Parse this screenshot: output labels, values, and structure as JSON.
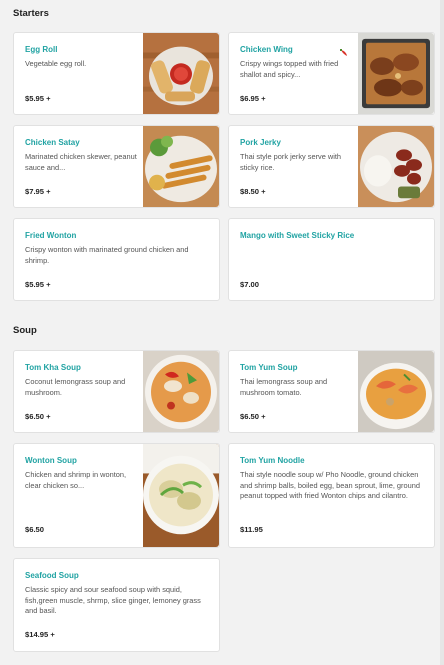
{
  "sections": [
    {
      "title": "Starters",
      "items": [
        {
          "name": "Egg Roll",
          "description": "Vegetable egg roll.",
          "price": "$5.95 +",
          "image": "egg-roll-photo"
        },
        {
          "name": "Chicken Wing",
          "description": "Crispy wings topped with fried shallot and spicy...",
          "price": "$6.95 +",
          "image": "chicken-wing-photo",
          "badge_icon": "chili-pepper-icon"
        },
        {
          "name": "Chicken Satay",
          "description": "Marinated chicken skewer, peanut sauce and...",
          "price": "$7.95 +",
          "image": "chicken-satay-photo"
        },
        {
          "name": "Pork Jerky",
          "description": "Thai style pork jerky serve with sticky rice.",
          "price": "$8.50 +",
          "image": "pork-jerky-photo"
        },
        {
          "name": "Fried Wonton",
          "description": "Crispy wonton with marinated ground chicken and shrimp.",
          "price": "$5.95 +"
        },
        {
          "name": "Mango with Sweet Sticky Rice",
          "description": "",
          "price": "$7.00"
        }
      ]
    },
    {
      "title": "Soup",
      "items": [
        {
          "name": "Tom Kha Soup",
          "description": "Coconut lemongrass soup and mushroom.",
          "price": "$6.50 +",
          "image": "tom-kha-photo"
        },
        {
          "name": "Tom Yum Soup",
          "description": "Thai lemongrass soup and mushroom tomato.",
          "price": "$6.50 +",
          "image": "tom-yum-photo"
        },
        {
          "name": "Wonton Soup",
          "description": "Chicken and shrimp in wonton, clear chicken so...",
          "price": "$6.50",
          "image": "wonton-soup-photo"
        },
        {
          "name": "Tom Yum Noodle",
          "description": "Thai style noodle soup w/ Pho Noodle, ground chicken and shrimp balls, boiled egg, bean sprout, lime, ground peanut topped with fried Wonton chips and cilantro.",
          "price": "$11.95"
        },
        {
          "name": "Seafood Soup",
          "description": "Classic spicy and sour seafood soup with squid, fish,green muscle, shrmp, slice ginger, lemoney grass and basil.",
          "price": "$14.95 +"
        }
      ]
    }
  ],
  "colors": {
    "accent": "#21a3a3",
    "background": "#f2f2f2",
    "card": "#ffffff",
    "chili": "#d9342b"
  }
}
